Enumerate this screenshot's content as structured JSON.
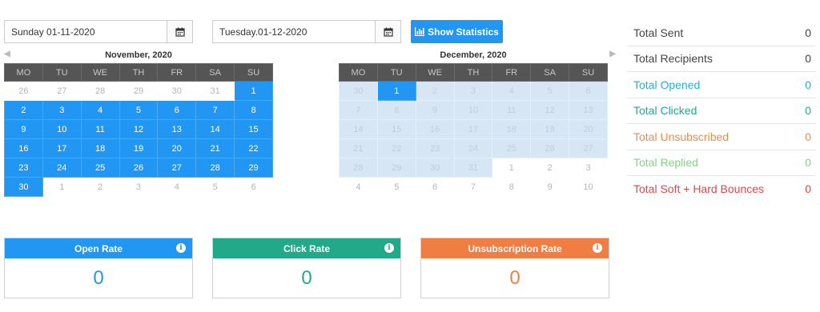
{
  "start_date": "Sunday 01-11-2020",
  "end_date": "Tuesday.01-12-2020",
  "show_statistics_label": "Show Statistics",
  "weekdays": [
    "MO",
    "TU",
    "WE",
    "TH",
    "FR",
    "SA",
    "SU"
  ],
  "calendar_left": {
    "title": "November, 2020",
    "rows": [
      [
        {
          "d": "26",
          "s": "off"
        },
        {
          "d": "27",
          "s": "off"
        },
        {
          "d": "28",
          "s": "off"
        },
        {
          "d": "29",
          "s": "off"
        },
        {
          "d": "30",
          "s": "off"
        },
        {
          "d": "31",
          "s": "off"
        },
        {
          "d": "1",
          "s": "sel"
        }
      ],
      [
        {
          "d": "2",
          "s": "sel"
        },
        {
          "d": "3",
          "s": "sel"
        },
        {
          "d": "4",
          "s": "sel"
        },
        {
          "d": "5",
          "s": "sel"
        },
        {
          "d": "6",
          "s": "sel"
        },
        {
          "d": "7",
          "s": "sel"
        },
        {
          "d": "8",
          "s": "sel"
        }
      ],
      [
        {
          "d": "9",
          "s": "sel"
        },
        {
          "d": "10",
          "s": "sel"
        },
        {
          "d": "11",
          "s": "sel"
        },
        {
          "d": "12",
          "s": "sel"
        },
        {
          "d": "13",
          "s": "sel"
        },
        {
          "d": "14",
          "s": "sel"
        },
        {
          "d": "15",
          "s": "sel"
        }
      ],
      [
        {
          "d": "16",
          "s": "sel"
        },
        {
          "d": "17",
          "s": "sel"
        },
        {
          "d": "18",
          "s": "sel"
        },
        {
          "d": "19",
          "s": "sel"
        },
        {
          "d": "20",
          "s": "sel"
        },
        {
          "d": "21",
          "s": "sel"
        },
        {
          "d": "22",
          "s": "sel"
        }
      ],
      [
        {
          "d": "23",
          "s": "sel"
        },
        {
          "d": "24",
          "s": "sel"
        },
        {
          "d": "25",
          "s": "sel"
        },
        {
          "d": "26",
          "s": "sel"
        },
        {
          "d": "27",
          "s": "sel"
        },
        {
          "d": "28",
          "s": "sel"
        },
        {
          "d": "29",
          "s": "sel"
        }
      ],
      [
        {
          "d": "30",
          "s": "sel"
        },
        {
          "d": "1",
          "s": "off"
        },
        {
          "d": "2",
          "s": "off"
        },
        {
          "d": "3",
          "s": "off"
        },
        {
          "d": "4",
          "s": "off"
        },
        {
          "d": "5",
          "s": "off"
        },
        {
          "d": "6",
          "s": "off"
        }
      ]
    ]
  },
  "calendar_right": {
    "title": "December, 2020",
    "rows": [
      [
        {
          "d": "30",
          "s": "range"
        },
        {
          "d": "1",
          "s": "sel"
        },
        {
          "d": "2",
          "s": "range"
        },
        {
          "d": "3",
          "s": "range"
        },
        {
          "d": "4",
          "s": "range"
        },
        {
          "d": "5",
          "s": "range"
        },
        {
          "d": "6",
          "s": "range"
        }
      ],
      [
        {
          "d": "7",
          "s": "range"
        },
        {
          "d": "8",
          "s": "range"
        },
        {
          "d": "9",
          "s": "range"
        },
        {
          "d": "10",
          "s": "range"
        },
        {
          "d": "11",
          "s": "range"
        },
        {
          "d": "12",
          "s": "range"
        },
        {
          "d": "13",
          "s": "range"
        }
      ],
      [
        {
          "d": "14",
          "s": "range"
        },
        {
          "d": "15",
          "s": "range"
        },
        {
          "d": "16",
          "s": "range"
        },
        {
          "d": "17",
          "s": "range"
        },
        {
          "d": "18",
          "s": "range"
        },
        {
          "d": "19",
          "s": "range"
        },
        {
          "d": "20",
          "s": "range"
        }
      ],
      [
        {
          "d": "21",
          "s": "range"
        },
        {
          "d": "22",
          "s": "range"
        },
        {
          "d": "23",
          "s": "range"
        },
        {
          "d": "24",
          "s": "range"
        },
        {
          "d": "25",
          "s": "range"
        },
        {
          "d": "26",
          "s": "range"
        },
        {
          "d": "27",
          "s": "range"
        }
      ],
      [
        {
          "d": "28",
          "s": "range"
        },
        {
          "d": "29",
          "s": "range"
        },
        {
          "d": "30",
          "s": "range"
        },
        {
          "d": "31",
          "s": "range"
        },
        {
          "d": "1",
          "s": "off"
        },
        {
          "d": "2",
          "s": "off"
        },
        {
          "d": "3",
          "s": "off"
        }
      ],
      [
        {
          "d": "4",
          "s": "off"
        },
        {
          "d": "5",
          "s": "off"
        },
        {
          "d": "6",
          "s": "off"
        },
        {
          "d": "7",
          "s": "off"
        },
        {
          "d": "8",
          "s": "off"
        },
        {
          "d": "9",
          "s": "off"
        },
        {
          "d": "10",
          "s": "off"
        }
      ]
    ]
  },
  "stats": [
    {
      "label": "Total Sent",
      "value": "0",
      "color": "#444444"
    },
    {
      "label": "Total Recipients",
      "value": "0",
      "color": "#444444"
    },
    {
      "label": "Total Opened",
      "value": "0",
      "color": "#27b1c9"
    },
    {
      "label": "Total Clicked",
      "value": "0",
      "color": "#22a98a"
    },
    {
      "label": "Total Unsubscribed",
      "value": "0",
      "color": "#f08a4b"
    },
    {
      "label": "Total Replied",
      "value": "0",
      "color": "#7dd87d"
    },
    {
      "label": "Total Soft + Hard Bounces",
      "value": "0",
      "color": "#e0474c"
    }
  ],
  "rates": {
    "open": {
      "label": "Open Rate",
      "value": "0",
      "color": "#2196f3"
    },
    "click": {
      "label": "Click Rate",
      "value": "0",
      "color": "#22a98a"
    },
    "unsub": {
      "label": "Unsubscription Rate",
      "value": "0",
      "color": "#f07e43"
    }
  }
}
